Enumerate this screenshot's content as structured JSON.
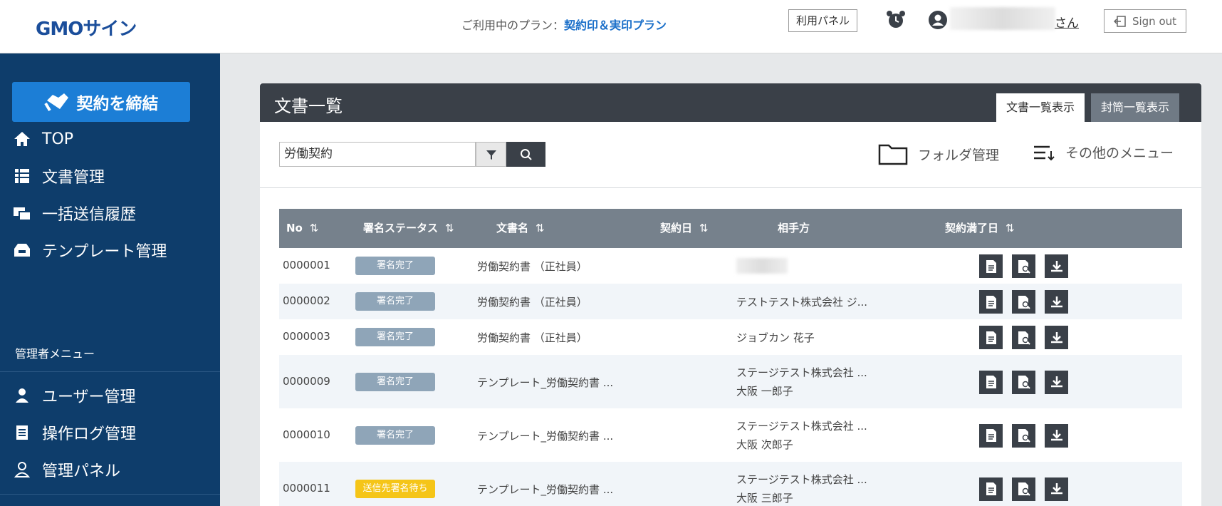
{
  "header": {
    "logo": "GMOサイン",
    "plan_label": "ご利用中のプラン：",
    "plan_name": "契約印＆実印プラン",
    "panel_button": "利用パネル",
    "user_suffix": "さん",
    "signout_label": "Sign out"
  },
  "sidebar": {
    "contract_button": "契約を締結",
    "items": [
      {
        "label": "TOP",
        "icon": "home-icon"
      },
      {
        "label": "文書管理",
        "icon": "table-icon"
      },
      {
        "label": "一括送信履歴",
        "icon": "batch-send-icon"
      },
      {
        "label": "テンプレート管理",
        "icon": "template-icon"
      }
    ],
    "admin_title": "管理者メニュー",
    "admin_items": [
      {
        "label": "ユーザー管理",
        "icon": "user-icon"
      },
      {
        "label": "操作ログ管理",
        "icon": "log-icon"
      },
      {
        "label": "管理パネル",
        "icon": "admin-panel-icon"
      }
    ]
  },
  "main": {
    "title": "文書一覧",
    "tabs": [
      {
        "label": "文書一覧表示",
        "active": true
      },
      {
        "label": "封筒一覧表示",
        "active": false
      }
    ],
    "search": {
      "value": "労働契約"
    },
    "folder_label": "フォルダ管理",
    "other_menu_label": "その他のメニュー",
    "table": {
      "columns": [
        "No",
        "署名ステータス",
        "文書名",
        "契約日",
        "相手方",
        "契約満了日"
      ],
      "rows": [
        {
          "no": "0000001",
          "status": "署名完了",
          "status_type": "done",
          "doc": "労働契約書 （正社員）",
          "date": "",
          "party1": "",
          "party2": "",
          "expiry": ""
        },
        {
          "no": "0000002",
          "status": "署名完了",
          "status_type": "done",
          "doc": "労働契約書 （正社員）",
          "date": "",
          "party1": "テストテスト株式会社 ジ...",
          "party2": "",
          "expiry": ""
        },
        {
          "no": "0000003",
          "status": "署名完了",
          "status_type": "done",
          "doc": "労働契約書 （正社員）",
          "date": "",
          "party1": "ジョブカン 花子",
          "party2": "",
          "expiry": ""
        },
        {
          "no": "0000009",
          "status": "署名完了",
          "status_type": "done",
          "doc": "テンプレート_労働契約書 ...",
          "date": "",
          "party1": "ステージテスト株式会社 ...",
          "party2": "大阪 一郎子",
          "expiry": ""
        },
        {
          "no": "0000010",
          "status": "署名完了",
          "status_type": "done",
          "doc": "テンプレート_労働契約書 ...",
          "date": "",
          "party1": "ステージテスト株式会社 ...",
          "party2": "大阪 次郎子",
          "expiry": ""
        },
        {
          "no": "0000011",
          "status": "送信先署名待ち",
          "status_type": "wait",
          "doc": "テンプレート_労働契約書 ...",
          "date": "",
          "party1": "ステージテスト株式会社 ...",
          "party2": "大阪 三郎子",
          "expiry": ""
        }
      ]
    }
  }
}
